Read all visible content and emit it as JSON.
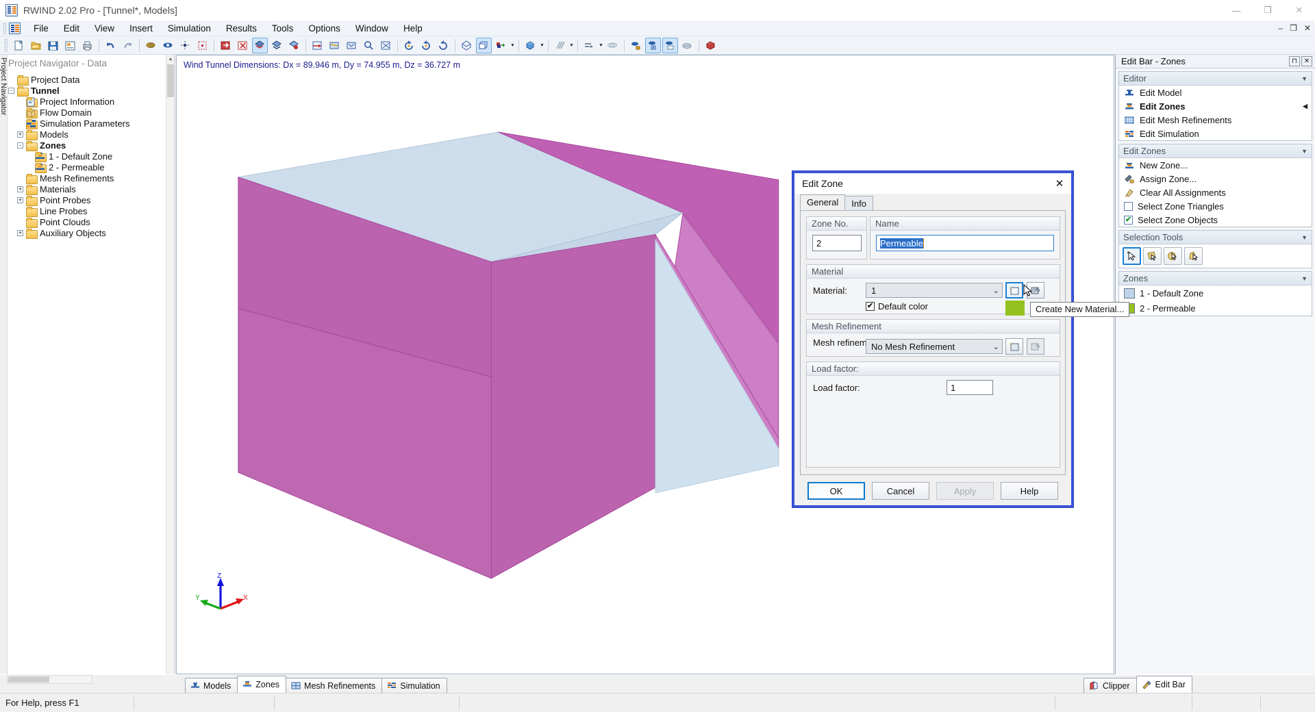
{
  "window": {
    "title": "RWIND 2.02 Pro - [Tunnel*, Models]",
    "app_icon": "rwind-icon",
    "minimize": "—",
    "maximize": "❐",
    "close": "✕"
  },
  "mdi_buttons": {
    "minimize": "–",
    "restore": "❐",
    "close": "✕"
  },
  "menubar": {
    "items": [
      {
        "label": "File"
      },
      {
        "label": "Edit"
      },
      {
        "label": "View"
      },
      {
        "label": "Insert"
      },
      {
        "label": "Simulation"
      },
      {
        "label": "Results"
      },
      {
        "label": "Tools"
      },
      {
        "label": "Options"
      },
      {
        "label": "Window"
      },
      {
        "label": "Help"
      }
    ]
  },
  "toolbar": {
    "groups": [
      [
        "new-icon",
        "open-icon",
        "save-icon",
        "print-preview-icon",
        "print-icon"
      ],
      [
        "undo-icon",
        "redo-icon"
      ],
      [
        "mesh-icon",
        "visibility-icon",
        "snap-icon",
        "selection-box-icon"
      ],
      [
        "model-in-icon",
        "model-out-icon",
        "render-solid-icon",
        "render-wire-icon",
        "render-shaded-icon"
      ],
      [
        "wind-tunnel-icon",
        "flow-icon",
        "result-icon",
        "zoom-icon",
        "fit-icon"
      ],
      [
        "rotate-left-icon",
        "rotate-right-icon",
        "rotate-free-icon"
      ],
      [
        "iso-view-icon",
        "perspective-icon",
        "axis-icon"
      ],
      [
        "box-view-icon"
      ],
      [
        "section-icon"
      ],
      [
        "arrow-flow-icon",
        "streamline-icon"
      ],
      [
        "probe-icon",
        "probe-point-icon",
        "probe-line-icon",
        "probe-cloud-icon"
      ],
      [
        "final-icon"
      ]
    ]
  },
  "navigator": {
    "vertical_tabs": [
      "Project Navigator"
    ],
    "title": "Project Navigator - Data",
    "tree": [
      {
        "label": "Project Data",
        "depth": 0,
        "icon": "folder-icon",
        "expander": "",
        "bold": false
      },
      {
        "label": "Tunnel",
        "depth": 0,
        "icon": "folder-open-icon",
        "expander": "-",
        "bold": true
      },
      {
        "label": "Project Information",
        "depth": 1,
        "icon": "project-info-icon",
        "expander": "",
        "bold": false
      },
      {
        "label": "Flow Domain",
        "depth": 1,
        "icon": "flow-domain-icon",
        "expander": "",
        "bold": false
      },
      {
        "label": "Simulation Parameters",
        "depth": 1,
        "icon": "simulation-params-icon",
        "expander": "",
        "bold": false
      },
      {
        "label": "Models",
        "depth": 1,
        "icon": "folder-icon",
        "expander": "+",
        "bold": false
      },
      {
        "label": "Zones",
        "depth": 1,
        "icon": "folder-open-icon",
        "expander": "-",
        "bold": true
      },
      {
        "label": "1 - Default Zone",
        "depth": 2,
        "icon": "zone-icon",
        "expander": "",
        "bold": false
      },
      {
        "label": "2 - Permeable",
        "depth": 2,
        "icon": "zone-icon",
        "expander": "",
        "bold": false
      },
      {
        "label": "Mesh Refinements",
        "depth": 1,
        "icon": "folder-icon",
        "expander": "",
        "bold": false
      },
      {
        "label": "Materials",
        "depth": 1,
        "icon": "folder-icon",
        "expander": "+",
        "bold": false
      },
      {
        "label": "Point Probes",
        "depth": 1,
        "icon": "folder-icon",
        "expander": "+",
        "bold": false
      },
      {
        "label": "Line Probes",
        "depth": 1,
        "icon": "folder-icon",
        "expander": "",
        "bold": false
      },
      {
        "label": "Point Clouds",
        "depth": 1,
        "icon": "folder-icon",
        "expander": "",
        "bold": false
      },
      {
        "label": "Auxiliary Objects",
        "depth": 1,
        "icon": "folder-icon",
        "expander": "+",
        "bold": false
      }
    ]
  },
  "viewport": {
    "dimensions_label": "Wind Tunnel Dimensions: Dx = 89.946 m, Dy = 74.955 m, Dz = 36.727 m",
    "axes": {
      "x": "X",
      "y": "Y",
      "z": "Z"
    },
    "box_colors": {
      "top_face": "#ccdded",
      "front_left_face": "#bd68ad",
      "front_left_lower": "#b8579f",
      "back_right_face": "#c469bb",
      "right_face": "#cb7ec4",
      "inner_bottom": "#cfe0ee",
      "floor_face": "#cfe0ee"
    }
  },
  "dialog": {
    "title": "Edit Zone",
    "close_icon": "close-icon",
    "tabs": [
      {
        "label": "General",
        "active": true
      },
      {
        "label": "Info",
        "active": false
      }
    ],
    "zone_no": {
      "group_label": "Zone No.",
      "value": "2"
    },
    "name": {
      "group_label": "Name",
      "value": "Permeable",
      "selected": true
    },
    "material": {
      "group_label": "Material",
      "field_label": "Material:",
      "value": "1",
      "default_color_label": "Default color",
      "default_color_checked": true,
      "new_button_icon": "new-material-icon",
      "edit_button_icon": "edit-material-icon",
      "swatch_color": "#94c11f"
    },
    "mesh_refinement": {
      "group_label": "Mesh Refinement",
      "field_label": "Mesh refinement:",
      "value": "No Mesh Refinement",
      "new_button_icon": "new-mesh-icon",
      "edit_button_icon": "edit-mesh-icon"
    },
    "load_factor": {
      "group_label": "Load factor:",
      "field_label": "Load factor:",
      "value": "1"
    },
    "buttons": [
      {
        "label": "OK",
        "state": "default"
      },
      {
        "label": "Cancel",
        "state": "normal"
      },
      {
        "label": "Apply",
        "state": "disabled"
      },
      {
        "label": "Help",
        "state": "normal"
      }
    ],
    "tooltip": "Create New Material..."
  },
  "editbar": {
    "title": "Edit Bar - Zones",
    "pin_icon": "pin-icon",
    "close_icon": "close-icon",
    "groups": [
      {
        "title": "Editor",
        "collapse_icon": "chevron-down-icon",
        "items": [
          {
            "label": "Edit Model",
            "icon": "edit-model-icon",
            "bold": false,
            "marker": ""
          },
          {
            "label": "Edit Zones",
            "icon": "edit-zones-icon",
            "bold": true,
            "marker": "◀"
          },
          {
            "label": "Edit Mesh Refinements",
            "icon": "edit-mesh-refinements-icon",
            "bold": false,
            "marker": ""
          },
          {
            "label": "Edit Simulation",
            "icon": "edit-simulation-icon",
            "bold": false,
            "marker": ""
          }
        ]
      },
      {
        "title": "Edit Zones",
        "collapse_icon": "chevron-down-icon",
        "items": [
          {
            "label": "New Zone...",
            "icon": "new-zone-icon",
            "bold": false,
            "marker": ""
          },
          {
            "label": "Assign Zone...",
            "icon": "assign-zone-icon",
            "bold": false,
            "marker": ""
          },
          {
            "label": "Clear All Assignments",
            "icon": "clear-assignments-icon",
            "bold": false,
            "marker": ""
          },
          {
            "label": "Select Zone Triangles",
            "icon": "checkbox-unchecked-icon",
            "bold": false,
            "marker": ""
          },
          {
            "label": "Select Zone Objects",
            "icon": "checkbox-checked-icon",
            "bold": false,
            "marker": ""
          }
        ]
      }
    ],
    "selection_tools": {
      "title": "Selection Tools",
      "collapse_icon": "chevron-down-icon",
      "tools": [
        {
          "name": "single-select-tool",
          "active": true
        },
        {
          "name": "rectangle-select-tool",
          "active": false
        },
        {
          "name": "circle-select-tool",
          "active": false
        },
        {
          "name": "polygon-select-tool",
          "active": false
        }
      ]
    },
    "zones": {
      "title": "Zones",
      "collapse_icon": "chevron-down-icon",
      "items": [
        {
          "label": "1 - Default Zone",
          "color": "#bdd4ea"
        },
        {
          "label": "2 - Permeable",
          "color": "#94c11f"
        }
      ]
    }
  },
  "bottom_tabs": {
    "left": [
      {
        "label": "Models",
        "icon": "models-icon",
        "active": false
      },
      {
        "label": "Zones",
        "icon": "zones-icon",
        "active": true
      },
      {
        "label": "Mesh Refinements",
        "icon": "mesh-refinements-icon",
        "active": false
      },
      {
        "label": "Simulation",
        "icon": "simulation-icon",
        "active": false
      }
    ],
    "right": [
      {
        "label": "Clipper",
        "icon": "clipper-icon",
        "active": false
      },
      {
        "label": "Edit Bar",
        "icon": "edit-bar-icon",
        "active": true
      }
    ]
  },
  "statusbar": {
    "message": "For Help, press F1"
  }
}
